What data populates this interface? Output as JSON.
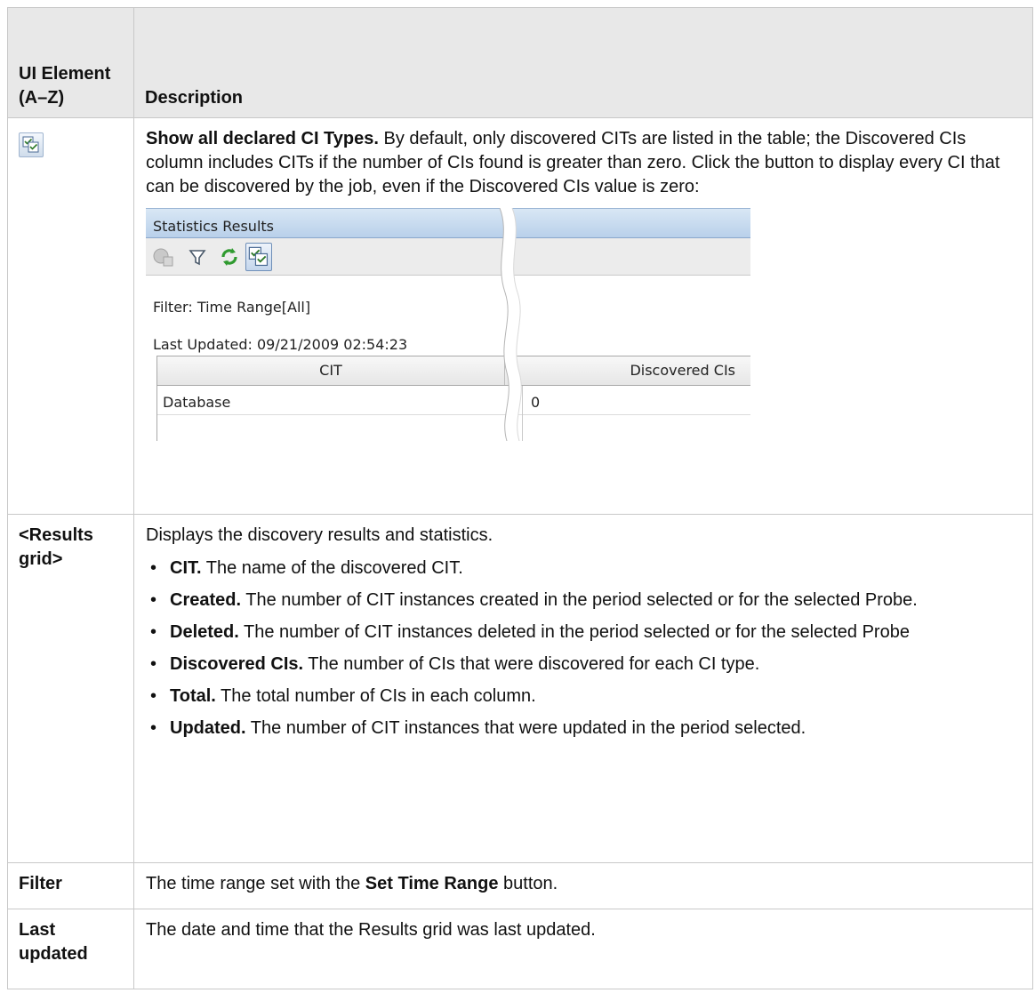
{
  "header": {
    "col1": "UI Element (A–Z)",
    "col2": "Description"
  },
  "icon_row": {
    "icon": "show-all-declared-ci-types-icon",
    "term": "Show all declared CI Types.",
    "description": " By default, only discovered CITs are listed in the table; the Discovered CIs column includes CITs if the number of CIs found is greater than zero. Click the button to display every CI that can be discovered by the job, even if the Discovered CIs value is zero:",
    "screenshot": {
      "title": "Statistics Results",
      "toolbar_icons": [
        "properties-icon",
        "filter-icon",
        "refresh-icon",
        "show-all-declared-ci-types-icon"
      ],
      "filter_line": "Filter: Time Range[All]",
      "updated_line": "Last Updated: 09/21/2009 02:54:23",
      "grid": {
        "columns": [
          "CIT",
          "Discovered CIs"
        ],
        "rows": [
          {
            "cit": "Database",
            "discovered": "0"
          }
        ]
      }
    }
  },
  "results_row": {
    "term": "<Results grid>",
    "intro": "Displays the discovery results and statistics.",
    "bullets": [
      {
        "term": "CIT.",
        "text": " The name of the discovered CIT."
      },
      {
        "term": "Created.",
        "text": " The number of CIT instances created in the period selected or for the selected Probe."
      },
      {
        "term": "Deleted.",
        "text": " The number of CIT instances deleted in the period selected or for the selected Probe"
      },
      {
        "term": "Discovered CIs.",
        "text": " The number of CIs that were discovered for each CI type."
      },
      {
        "term": "Total.",
        "text": " The total number of CIs in each column."
      },
      {
        "term": "Updated.",
        "text": " The number of CIT instances that were updated in the period selected."
      }
    ]
  },
  "filter_row": {
    "term": "Filter",
    "text_before": "The time range set with the ",
    "bold": "Set Time Range",
    "text_after": " button."
  },
  "last_updated_row": {
    "term": "Last updated",
    "text": "The date and time that the Results grid was last updated."
  }
}
